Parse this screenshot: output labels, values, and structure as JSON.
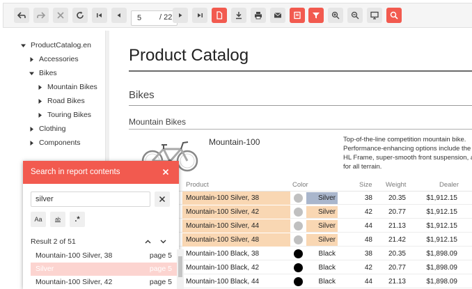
{
  "toolbar": {
    "page_value": "5",
    "page_total": "/ 22",
    "buttons": [
      "undo-icon",
      "redo-icon",
      "close-icon",
      "refresh-icon",
      "first-page-icon",
      "prev-page-icon",
      "next-page-icon",
      "last-page-icon",
      "document-icon",
      "download-icon",
      "print-icon",
      "email-icon",
      "save-icon",
      "filter-icon",
      "zoom-in-icon",
      "zoom-out-icon",
      "fullscreen-icon",
      "search-icon"
    ]
  },
  "tree": {
    "root": "ProductCatalog.en",
    "items": [
      {
        "label": "Accessories"
      },
      {
        "label": "Bikes"
      },
      {
        "label": "Mountain Bikes"
      },
      {
        "label": "Road Bikes"
      },
      {
        "label": "Touring Bikes"
      },
      {
        "label": "Clothing"
      },
      {
        "label": "Components"
      }
    ]
  },
  "report": {
    "title": "Product Catalog",
    "section": "Bikes",
    "subsection": "Mountain Bikes",
    "model": "Mountain-100",
    "description": [
      "Top-of-the-line competition mountain bike.",
      "Performance-enhancing options include the i",
      "HL Frame, super-smooth front suspension, an",
      "for all terrain."
    ],
    "columns": {
      "product": "Product",
      "color": "Color",
      "size": "Size",
      "weight": "Weight",
      "dealer": "Dealer"
    },
    "rows": [
      {
        "product": "Mountain-100 Silver, 38",
        "color": "Silver",
        "size": "38",
        "weight": "20.35",
        "dealer": "$1,912.15"
      },
      {
        "product": "Mountain-100 Silver, 42",
        "color": "Silver",
        "size": "42",
        "weight": "20.77",
        "dealer": "$1,912.15"
      },
      {
        "product": "Mountain-100 Silver, 44",
        "color": "Silver",
        "size": "44",
        "weight": "21.13",
        "dealer": "$1,912.15"
      },
      {
        "product": "Mountain-100 Silver, 48",
        "color": "Silver",
        "size": "48",
        "weight": "21.42",
        "dealer": "$1,912.15"
      },
      {
        "product": "Mountain-100 Black, 38",
        "color": "Black",
        "size": "38",
        "weight": "20.35",
        "dealer": "$1,898.09"
      },
      {
        "product": "Mountain-100 Black, 42",
        "color": "Black",
        "size": "42",
        "weight": "20.77",
        "dealer": "$1,898.09"
      },
      {
        "product": "Mountain-100 Black, 44",
        "color": "Black",
        "size": "44",
        "weight": "21.13",
        "dealer": "$1,898.09"
      }
    ]
  },
  "search": {
    "title": "Search in report contents",
    "query": "silver",
    "options": [
      "Aa",
      "ab",
      ".*"
    ],
    "result_text": "Result 2 of 51",
    "results": [
      {
        "name": "Mountain-100 Silver, 38",
        "page": "page 5"
      },
      {
        "name": "Silver",
        "page": "page 5"
      },
      {
        "name": "Mountain-100 Silver, 42",
        "page": "page 5"
      }
    ]
  },
  "colors": {
    "accent": "#f25a4f",
    "highlight": "#f9d7b3",
    "silver_cell": "#a9b6cc",
    "silver_dot": "#c0c0c0",
    "black_dot": "#000000"
  }
}
